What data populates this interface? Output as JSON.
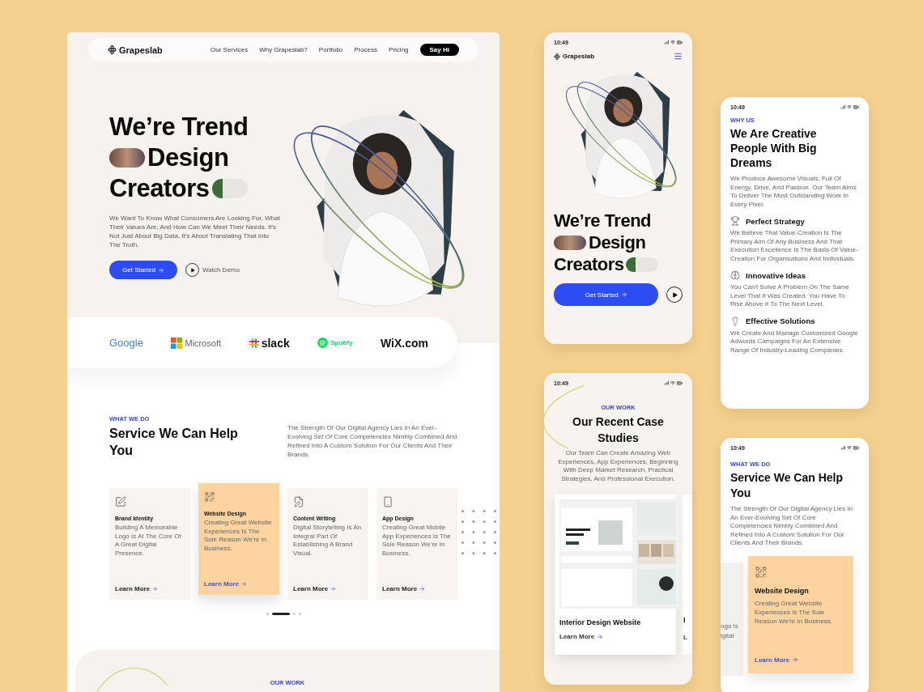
{
  "desktop": {
    "nav": {
      "logo": "Grapeslab",
      "links": [
        "Our Services",
        "Why Grapeslab?",
        "Portfolio",
        "Process",
        "Pricing"
      ],
      "cta": "Say Hi"
    },
    "hero": {
      "title_lines": [
        {
          "text": "We’re Trend",
          "photo_before": false,
          "photo_after": false
        },
        {
          "text": "Design",
          "photo_before": true,
          "photo_after": false
        },
        {
          "text": "Creators",
          "photo_before": false,
          "photo_after": true
        }
      ],
      "text": "We Want To Know What Consumers Are Looking For, What Their Values Are, And How Can We Meet Their Needs. It's Not Just About Big Data, It's About Translating That Into The Truth.",
      "primary": "Get Started",
      "secondary": "Watch Demo"
    },
    "logos": [
      {
        "name": "Google",
        "kind": "google"
      },
      {
        "name": "Microsoft",
        "kind": "microsoft"
      },
      {
        "name": "slack",
        "kind": "slack"
      },
      {
        "name": "Spotify",
        "kind": "spotify"
      },
      {
        "name": "WiX.com",
        "kind": "wix"
      }
    ],
    "services": {
      "eyebrow": "WHAT WE DO",
      "title": "Service We Can Help You",
      "text": "The Strength Of Our Digital Agency Lies In An Ever-Evolving Set Of Core Competencies Nimbly Combined And Refined Into A Custom Solution For Our Clients And Their Brands.",
      "cards": [
        {
          "title": "Brand Identity",
          "text": "Building A Memorable Logo Is At The Core Of A Great Digital Presence.",
          "link": "Learn More",
          "selected": false
        },
        {
          "title": "Website Design",
          "text": "Creating Great Website Experiences Is The Sole Reason We're In Business.",
          "link": "Learn More",
          "selected": true
        },
        {
          "title": "Content Writing",
          "text": "Digital Storytelling Is An Integral Part Of Establishing A Brand Visual.",
          "link": "Learn More",
          "selected": false
        },
        {
          "title": "App Design",
          "text": "Creating Great Mobile App Experiences Is The Sole Reason We're In Business.",
          "link": "Learn More",
          "selected": false
        }
      ],
      "dots": [
        {
          "selected": false
        },
        {
          "selected": true
        },
        {
          "selected": false
        },
        {
          "selected": false
        }
      ]
    },
    "work": {
      "eyebrow": "OUR WORK"
    }
  },
  "phone_hero": {
    "time": "10:49",
    "logo": "Grapeslab",
    "title_lines": [
      {
        "text": "We’re Trend",
        "photo_before": false,
        "photo_after": false
      },
      {
        "text": "Design",
        "photo_before": true,
        "photo_after": false
      },
      {
        "text": "Creators",
        "photo_before": false,
        "photo_after": true
      }
    ],
    "primary": "Get Started"
  },
  "phone_work": {
    "time": "10:49",
    "eyebrow": "OUR WORK",
    "title": "Our Recent Case Studies",
    "text": "Our Team Can Create Amazing Web Experiences, App Experiences, Beginning With Deep Market Research, Practical Strategies, And Professional Execution.",
    "cards": [
      {
        "title": "Interior Design Website",
        "link": "Learn More"
      },
      {
        "title": "I",
        "link": "L"
      }
    ]
  },
  "phone_why": {
    "time": "10:49",
    "eyebrow": "WHY US",
    "title": "We Are Creative People With Big Dreams",
    "text": "We Produce Awesome Visuals, Full Of Energy, Drive, And Passion. Our Team Aims To Deliver The Most Outstanding Work In Every Pixel.",
    "features": [
      {
        "title": "Perfect Strategy",
        "text": "We Believe That Value-Creation Is The Primary Aim Of Any Business And That Execution Excellence Is The Basis Of Value-Creation For Organisations And Individuals."
      },
      {
        "title": "Innovative Ideas",
        "text": "You Can't Solve A Problem On The Same Level That It Was Created. You Have To Rise Above It To The Next Level."
      },
      {
        "title": "Effective Solutions",
        "text": "We Create And Manage Customized Google Adwords Campaigns For An Extensive Range Of Industry-Leading Companies."
      }
    ]
  },
  "phone_services": {
    "time": "10:49",
    "eyebrow": "WHAT WE DO",
    "title": "Service We Can Help You",
    "text": "The Strength Of Our Digital Agency Lies In An Ever-Evolving Set Of Core Competencies Nimbly Combined And Refined Into A Custom Solution For Our Clients And Their Brands.",
    "previous_card_lines": [
      "ogo Is",
      "igital"
    ],
    "card": {
      "title": "Website Design",
      "text": "Creating Great Website Experiences Is The Sole Reason We're In Business.",
      "link": "Learn More"
    }
  }
}
